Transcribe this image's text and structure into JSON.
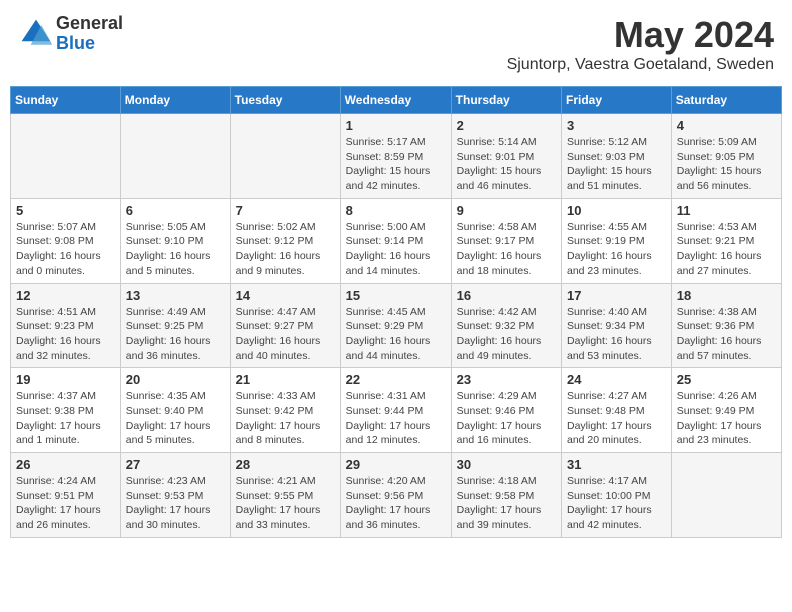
{
  "header": {
    "logo": {
      "general": "General",
      "blue": "Blue"
    },
    "title": "May 2024",
    "location": "Sjuntorp, Vaestra Goetaland, Sweden"
  },
  "days_of_week": [
    "Sunday",
    "Monday",
    "Tuesday",
    "Wednesday",
    "Thursday",
    "Friday",
    "Saturday"
  ],
  "weeks": [
    [
      {
        "day": "",
        "info": ""
      },
      {
        "day": "",
        "info": ""
      },
      {
        "day": "",
        "info": ""
      },
      {
        "day": "1",
        "info": "Sunrise: 5:17 AM\nSunset: 8:59 PM\nDaylight: 15 hours\nand 42 minutes."
      },
      {
        "day": "2",
        "info": "Sunrise: 5:14 AM\nSunset: 9:01 PM\nDaylight: 15 hours\nand 46 minutes."
      },
      {
        "day": "3",
        "info": "Sunrise: 5:12 AM\nSunset: 9:03 PM\nDaylight: 15 hours\nand 51 minutes."
      },
      {
        "day": "4",
        "info": "Sunrise: 5:09 AM\nSunset: 9:05 PM\nDaylight: 15 hours\nand 56 minutes."
      }
    ],
    [
      {
        "day": "5",
        "info": "Sunrise: 5:07 AM\nSunset: 9:08 PM\nDaylight: 16 hours\nand 0 minutes."
      },
      {
        "day": "6",
        "info": "Sunrise: 5:05 AM\nSunset: 9:10 PM\nDaylight: 16 hours\nand 5 minutes."
      },
      {
        "day": "7",
        "info": "Sunrise: 5:02 AM\nSunset: 9:12 PM\nDaylight: 16 hours\nand 9 minutes."
      },
      {
        "day": "8",
        "info": "Sunrise: 5:00 AM\nSunset: 9:14 PM\nDaylight: 16 hours\nand 14 minutes."
      },
      {
        "day": "9",
        "info": "Sunrise: 4:58 AM\nSunset: 9:17 PM\nDaylight: 16 hours\nand 18 minutes."
      },
      {
        "day": "10",
        "info": "Sunrise: 4:55 AM\nSunset: 9:19 PM\nDaylight: 16 hours\nand 23 minutes."
      },
      {
        "day": "11",
        "info": "Sunrise: 4:53 AM\nSunset: 9:21 PM\nDaylight: 16 hours\nand 27 minutes."
      }
    ],
    [
      {
        "day": "12",
        "info": "Sunrise: 4:51 AM\nSunset: 9:23 PM\nDaylight: 16 hours\nand 32 minutes."
      },
      {
        "day": "13",
        "info": "Sunrise: 4:49 AM\nSunset: 9:25 PM\nDaylight: 16 hours\nand 36 minutes."
      },
      {
        "day": "14",
        "info": "Sunrise: 4:47 AM\nSunset: 9:27 PM\nDaylight: 16 hours\nand 40 minutes."
      },
      {
        "day": "15",
        "info": "Sunrise: 4:45 AM\nSunset: 9:29 PM\nDaylight: 16 hours\nand 44 minutes."
      },
      {
        "day": "16",
        "info": "Sunrise: 4:42 AM\nSunset: 9:32 PM\nDaylight: 16 hours\nand 49 minutes."
      },
      {
        "day": "17",
        "info": "Sunrise: 4:40 AM\nSunset: 9:34 PM\nDaylight: 16 hours\nand 53 minutes."
      },
      {
        "day": "18",
        "info": "Sunrise: 4:38 AM\nSunset: 9:36 PM\nDaylight: 16 hours\nand 57 minutes."
      }
    ],
    [
      {
        "day": "19",
        "info": "Sunrise: 4:37 AM\nSunset: 9:38 PM\nDaylight: 17 hours\nand 1 minute."
      },
      {
        "day": "20",
        "info": "Sunrise: 4:35 AM\nSunset: 9:40 PM\nDaylight: 17 hours\nand 5 minutes."
      },
      {
        "day": "21",
        "info": "Sunrise: 4:33 AM\nSunset: 9:42 PM\nDaylight: 17 hours\nand 8 minutes."
      },
      {
        "day": "22",
        "info": "Sunrise: 4:31 AM\nSunset: 9:44 PM\nDaylight: 17 hours\nand 12 minutes."
      },
      {
        "day": "23",
        "info": "Sunrise: 4:29 AM\nSunset: 9:46 PM\nDaylight: 17 hours\nand 16 minutes."
      },
      {
        "day": "24",
        "info": "Sunrise: 4:27 AM\nSunset: 9:48 PM\nDaylight: 17 hours\nand 20 minutes."
      },
      {
        "day": "25",
        "info": "Sunrise: 4:26 AM\nSunset: 9:49 PM\nDaylight: 17 hours\nand 23 minutes."
      }
    ],
    [
      {
        "day": "26",
        "info": "Sunrise: 4:24 AM\nSunset: 9:51 PM\nDaylight: 17 hours\nand 26 minutes."
      },
      {
        "day": "27",
        "info": "Sunrise: 4:23 AM\nSunset: 9:53 PM\nDaylight: 17 hours\nand 30 minutes."
      },
      {
        "day": "28",
        "info": "Sunrise: 4:21 AM\nSunset: 9:55 PM\nDaylight: 17 hours\nand 33 minutes."
      },
      {
        "day": "29",
        "info": "Sunrise: 4:20 AM\nSunset: 9:56 PM\nDaylight: 17 hours\nand 36 minutes."
      },
      {
        "day": "30",
        "info": "Sunrise: 4:18 AM\nSunset: 9:58 PM\nDaylight: 17 hours\nand 39 minutes."
      },
      {
        "day": "31",
        "info": "Sunrise: 4:17 AM\nSunset: 10:00 PM\nDaylight: 17 hours\nand 42 minutes."
      },
      {
        "day": "",
        "info": ""
      }
    ]
  ]
}
